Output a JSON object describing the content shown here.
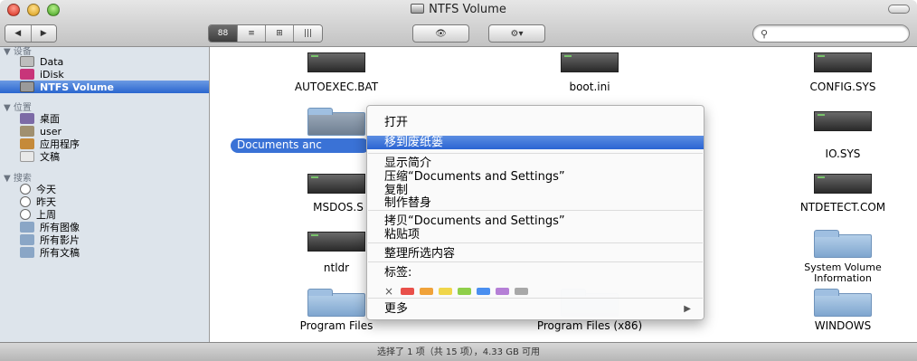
{
  "window": {
    "title": "NTFS Volume"
  },
  "toolbar": {
    "back": "◀",
    "forward": "▶",
    "views": [
      "88",
      "≡",
      "⊞",
      "|||"
    ],
    "eye": "👁",
    "gear": "⚙▾",
    "search_placeholder": ""
  },
  "sidebar": {
    "devices_header": "▼ 设备",
    "devices": [
      {
        "label": "Data",
        "color": "#b8b8b8"
      },
      {
        "label": "iDisk",
        "color": "#c8357a"
      },
      {
        "label": "NTFS Volume",
        "color": "#9a9a9a"
      }
    ],
    "places_header": "▼ 位置",
    "places": [
      {
        "label": "桌面",
        "color": "#7c6aa6"
      },
      {
        "label": "user",
        "color": "#a09070"
      },
      {
        "label": "应用程序",
        "color": "#c58a3a"
      },
      {
        "label": "文稿",
        "color": "#c8c8c8"
      }
    ],
    "search_header": "▼ 搜索",
    "searches": [
      {
        "label": "今天",
        "color": "#e0e0e0"
      },
      {
        "label": "昨天",
        "color": "#e0e0e0"
      },
      {
        "label": "上周",
        "color": "#e0e0e0"
      },
      {
        "label": "所有图像",
        "color": "#8aa6c6"
      },
      {
        "label": "所有影片",
        "color": "#8aa6c6"
      },
      {
        "label": "所有文稿",
        "color": "#8aa6c6"
      }
    ]
  },
  "files": [
    {
      "name": "AUTOEXEC.BAT",
      "kind": "doc"
    },
    {
      "name": "boot.ini",
      "kind": "doc"
    },
    {
      "name": "CONFIG.SYS",
      "kind": "doc"
    },
    {
      "name": "Documents and Settings",
      "label_visible": "Documents anc",
      "kind": "folder"
    },
    {
      "name": "IO.SYS",
      "kind": "doc"
    },
    {
      "name": "MSDOS.S",
      "kind": "doc"
    },
    {
      "name": "NTDETECT.COM",
      "kind": "doc"
    },
    {
      "name": "ntldr",
      "kind": "doc"
    },
    {
      "name": "System Volume Information",
      "label_line1": "System Volume",
      "label_line2": "Information",
      "kind": "folder"
    },
    {
      "name": "Program Files",
      "kind": "folder"
    },
    {
      "name": "Program Files (x86)",
      "kind": "folder"
    },
    {
      "name": "WINDOWS",
      "kind": "folder"
    }
  ],
  "context_menu": {
    "open": "打开",
    "move_to_trash": "移到废纸篓",
    "get_info": "显示简介",
    "compress": "压缩“Documents and Settings”",
    "duplicate": "复制",
    "make_alias": "制作替身",
    "copy": "拷贝“Documents and Settings”",
    "paste": "粘贴项",
    "arrange": "整理所选内容",
    "tags_label": "标签:",
    "tag_clear": "×",
    "tag_colors": [
      "#e9504a",
      "#f0a23a",
      "#f0d64a",
      "#8fcf4a",
      "#4a8ff0",
      "#b57fd6",
      "#a8a8a8"
    ],
    "more": "更多",
    "more_arrow": "▶"
  },
  "status": {
    "text": "选择了 1 项（共 15 项），4.33 GB 可用"
  }
}
